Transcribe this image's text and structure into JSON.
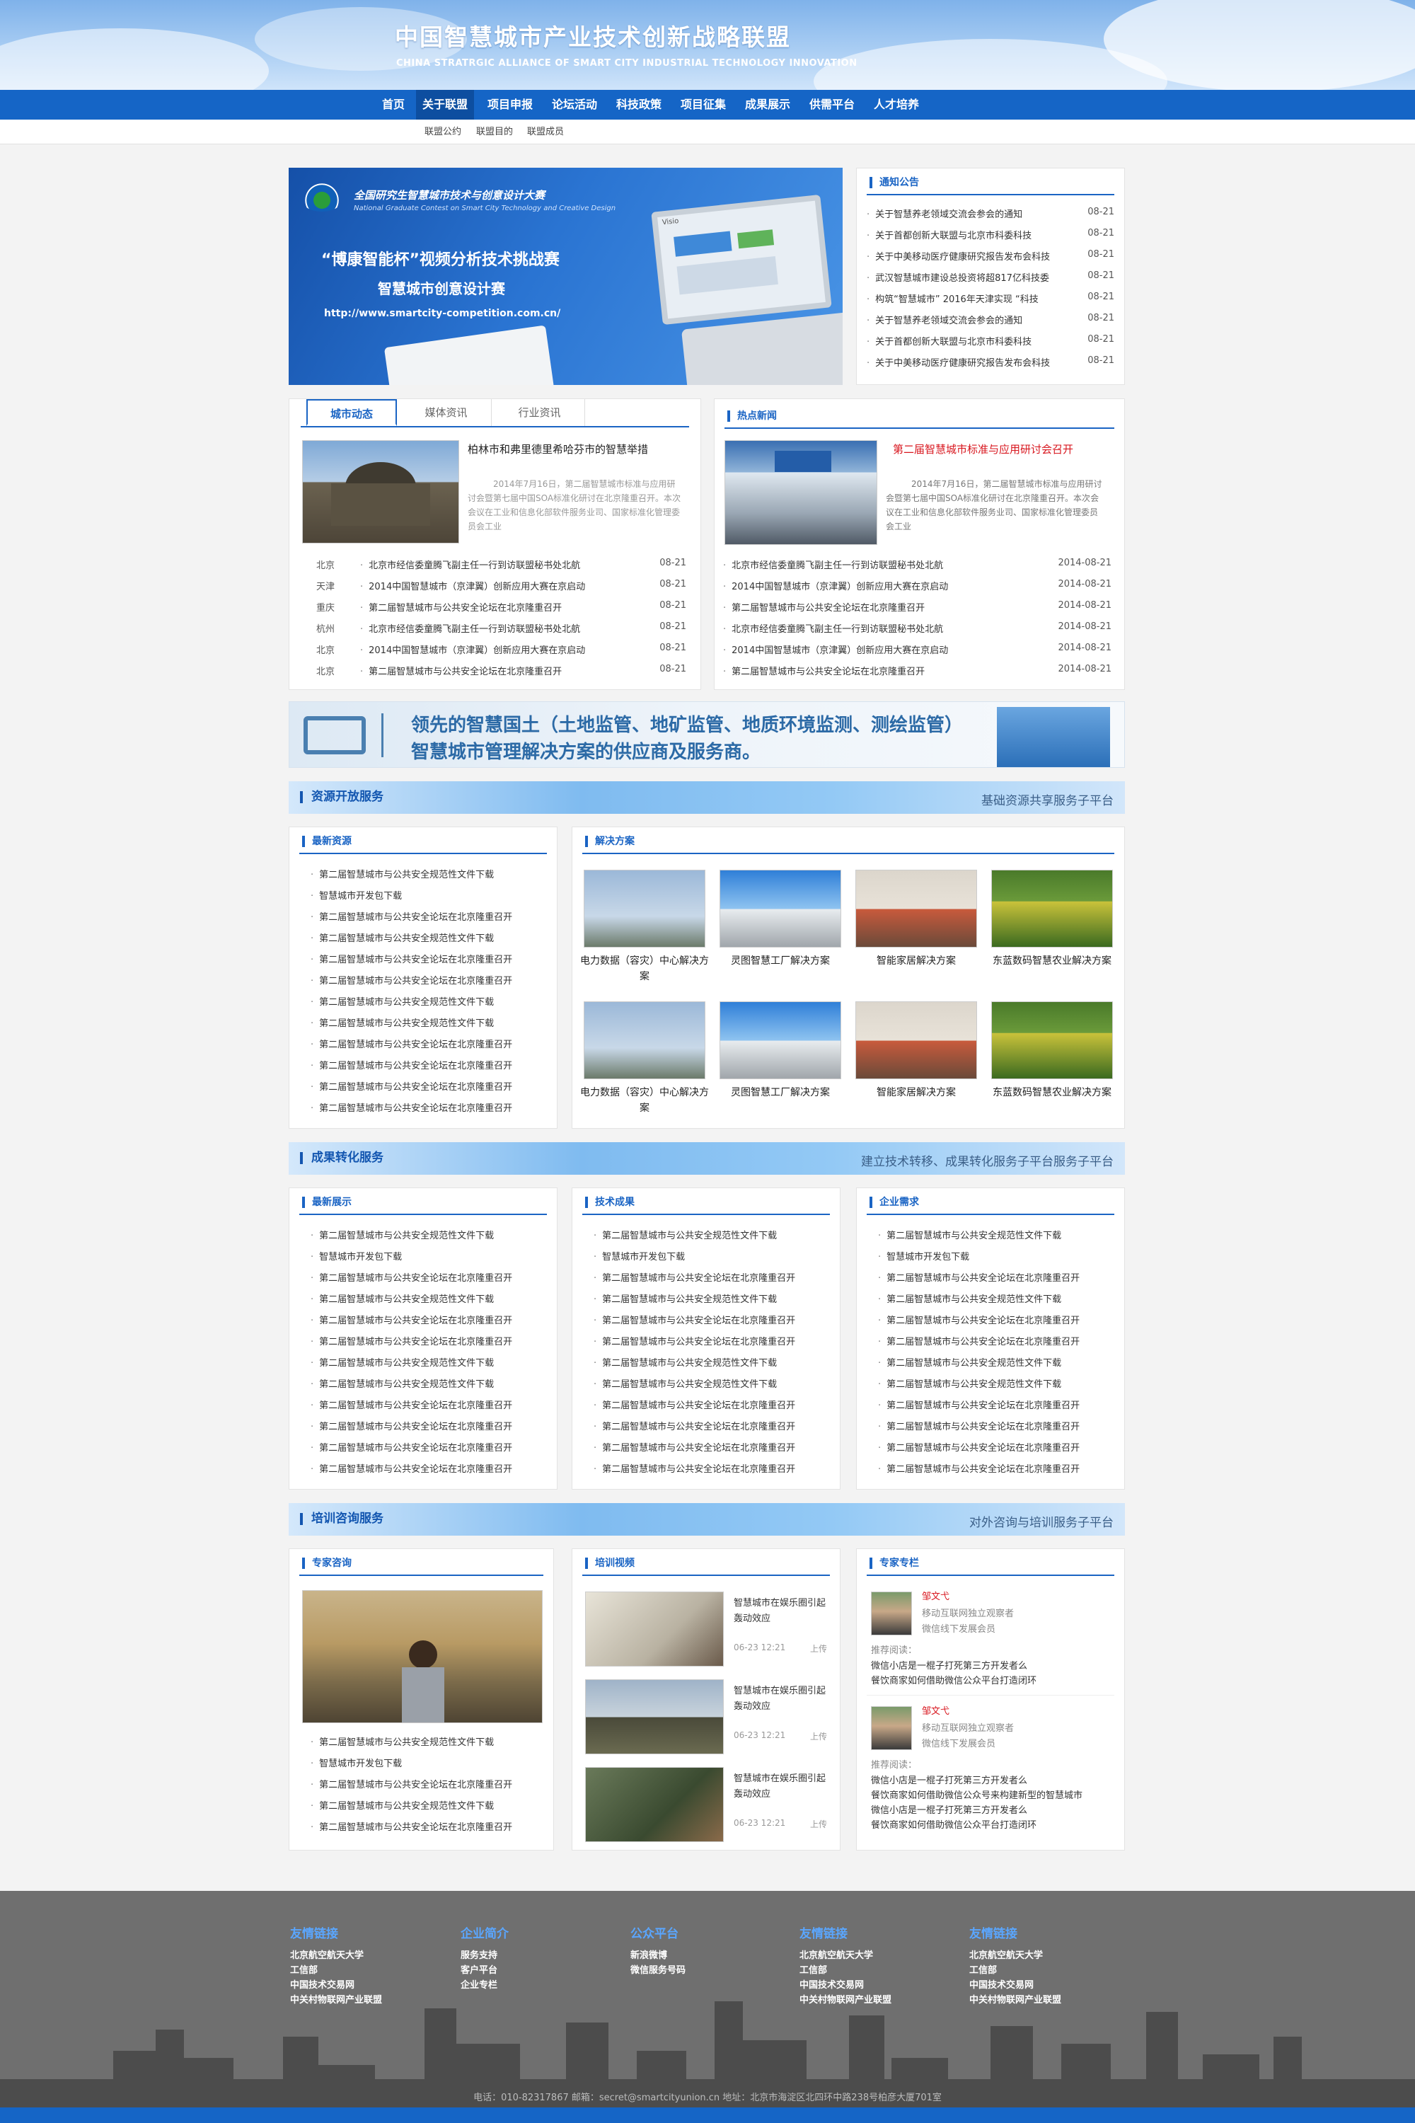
{
  "header": {
    "title": "中国智慧城市产业技术创新战略联盟",
    "subtitle": "CHINA STRATRGIC ALLIANCE OF SMART CITY INDUSTRIAL TECHNOLOGY INNOVATION"
  },
  "nav": [
    "首页",
    "关于联盟",
    "项目申报",
    "论坛活动",
    "科技政策",
    "项目征集",
    "成果展示",
    "供需平台",
    "人才培养"
  ],
  "subnav": [
    "联盟公约",
    "联盟目的",
    "联盟成员"
  ],
  "banner": {
    "line1": "全国研究生智慧城市技术与创意设计大赛",
    "line2": "National Graduate Contest on Smart City Technology and Creative Design",
    "line3": "“博康智能杯”视频分析技术挑战赛",
    "line4": "智慧城市创意设计赛",
    "url": "http://www.smartcity-competition.com.cn/",
    "screen": "Visio"
  },
  "notice": {
    "title": "通知公告",
    "items": [
      {
        "t": "关于智慧养老领域交流会参会的通知",
        "d": "08-21"
      },
      {
        "t": "关于首都创新大联盟与北京市科委科技",
        "d": "08-21"
      },
      {
        "t": "关于中美移动医疗健康研究报告发布会科技",
        "d": "08-21"
      },
      {
        "t": "武汉智慧城市建设总投资将超817亿科技委",
        "d": "08-21"
      },
      {
        "t": "构筑“智慧城市” 2016年天津实现 “科技",
        "d": "08-21"
      },
      {
        "t": "关于智慧养老领域交流会参会的通知",
        "d": "08-21"
      },
      {
        "t": "关于首都创新大联盟与北京市科委科技",
        "d": "08-21"
      },
      {
        "t": "关于中美移动医疗健康研究报告发布会科技",
        "d": "08-21"
      }
    ]
  },
  "city": {
    "tabs": [
      "城市动态",
      "媒体资讯",
      "行业资讯"
    ],
    "feature_title": "柏林市和弗里德里希哈芬市的智慧举措",
    "feature_text": "2014年7月16日，第二届智慧城市标准与应用研讨会暨第七届中国SOA标准化研讨在北京隆重召开。本次会议在工业和信息化部软件服务业司、国家标准化管理委员会工业",
    "items": [
      {
        "c": "北京",
        "t": "北京市经信委童腾飞副主任一行到访联盟秘书处北航",
        "d": "08-21"
      },
      {
        "c": "天津",
        "t": "2014中国智慧城市（京津翼）创新应用大赛在京启动",
        "d": "08-21"
      },
      {
        "c": "重庆",
        "t": "第二届智慧城市与公共安全论坛在北京隆重召开",
        "d": "08-21"
      },
      {
        "c": "杭州",
        "t": "北京市经信委童腾飞副主任一行到访联盟秘书处北航",
        "d": "08-21"
      },
      {
        "c": "北京",
        "t": "2014中国智慧城市（京津翼）创新应用大赛在京启动",
        "d": "08-21"
      },
      {
        "c": "北京",
        "t": "第二届智慧城市与公共安全论坛在北京隆重召开",
        "d": "08-21"
      }
    ]
  },
  "hot": {
    "title": "热点新闻",
    "feature_title": "第二届智慧城市标准与应用研讨会召开",
    "feature_text": "2014年7月16日，第二届智慧城市标准与应用研讨会暨第七届中国SOA标准化研讨在北京隆重召开。本次会议在工业和信息化部软件服务业司、国家标准化管理委员会工业",
    "items": [
      {
        "t": "北京市经信委童腾飞副主任一行到访联盟秘书处北航",
        "d": "2014-08-21"
      },
      {
        "t": "2014中国智慧城市（京津翼）创新应用大赛在京启动",
        "d": "2014-08-21"
      },
      {
        "t": "第二届智慧城市与公共安全论坛在北京隆重召开",
        "d": "2014-08-21"
      },
      {
        "t": "北京市经信委童腾飞副主任一行到访联盟秘书处北航",
        "d": "2014-08-21"
      },
      {
        "t": "2014中国智慧城市（京津翼）创新应用大赛在京启动",
        "d": "2014-08-21"
      },
      {
        "t": "第二届智慧城市与公共安全论坛在北京隆重召开",
        "d": "2014-08-21"
      }
    ]
  },
  "ad": {
    "line1": "领先的智慧国土（土地监管、地矿监管、地质环境监测、测绘监管）",
    "line2": "智慧城市管理解决方案的供应商及服务商。"
  },
  "sec1": {
    "left": "资源开放服务",
    "right": "基础资源共享服务子平台"
  },
  "latest": {
    "title": "最新资源",
    "items": [
      "第二届智慧城市与公共安全规范性文件下载",
      "智慧城市开发包下载",
      "第二届智慧城市与公共安全论坛在北京隆重召开",
      "第二届智慧城市与公共安全规范性文件下载",
      "第二届智慧城市与公共安全论坛在北京隆重召开",
      "第二届智慧城市与公共安全论坛在北京隆重召开",
      "第二届智慧城市与公共安全规范性文件下载",
      "第二届智慧城市与公共安全规范性文件下载",
      "第二届智慧城市与公共安全论坛在北京隆重召开",
      "第二届智慧城市与公共安全论坛在北京隆重召开",
      "第二届智慧城市与公共安全论坛在北京隆重召开",
      "第二届智慧城市与公共安全论坛在北京隆重召开"
    ]
  },
  "solutions": {
    "title": "解决方案",
    "items": [
      "电力数据（容灾）中心解决方案",
      "灵图智慧工厂解决方案",
      "智能家居解决方案",
      "东蓝数码智慧农业解决方案",
      "电力数据（容灾）中心解决方案",
      "灵图智慧工厂解决方案",
      "智能家居解决方案",
      "东蓝数码智慧农业解决方案"
    ]
  },
  "sec2": {
    "left": "成果转化服务",
    "right": "建立技术转移、成果转化服务子平台服务子平台"
  },
  "cols": [
    {
      "title": "最新展示",
      "items": [
        "第二届智慧城市与公共安全规范性文件下载",
        "智慧城市开发包下载",
        "第二届智慧城市与公共安全论坛在北京隆重召开",
        "第二届智慧城市与公共安全规范性文件下载",
        "第二届智慧城市与公共安全论坛在北京隆重召开",
        "第二届智慧城市与公共安全论坛在北京隆重召开",
        "第二届智慧城市与公共安全规范性文件下载",
        "第二届智慧城市与公共安全规范性文件下载",
        "第二届智慧城市与公共安全论坛在北京隆重召开",
        "第二届智慧城市与公共安全论坛在北京隆重召开",
        "第二届智慧城市与公共安全论坛在北京隆重召开",
        "第二届智慧城市与公共安全论坛在北京隆重召开"
      ]
    },
    {
      "title": "技术成果",
      "items": [
        "第二届智慧城市与公共安全规范性文件下载",
        "智慧城市开发包下载",
        "第二届智慧城市与公共安全论坛在北京隆重召开",
        "第二届智慧城市与公共安全规范性文件下载",
        "第二届智慧城市与公共安全论坛在北京隆重召开",
        "第二届智慧城市与公共安全论坛在北京隆重召开",
        "第二届智慧城市与公共安全规范性文件下载",
        "第二届智慧城市与公共安全规范性文件下载",
        "第二届智慧城市与公共安全论坛在北京隆重召开",
        "第二届智慧城市与公共安全论坛在北京隆重召开",
        "第二届智慧城市与公共安全论坛在北京隆重召开",
        "第二届智慧城市与公共安全论坛在北京隆重召开"
      ]
    },
    {
      "title": "企业需求",
      "items": [
        "第二届智慧城市与公共安全规范性文件下载",
        "智慧城市开发包下载",
        "第二届智慧城市与公共安全论坛在北京隆重召开",
        "第二届智慧城市与公共安全规范性文件下载",
        "第二届智慧城市与公共安全论坛在北京隆重召开",
        "第二届智慧城市与公共安全论坛在北京隆重召开",
        "第二届智慧城市与公共安全规范性文件下载",
        "第二届智慧城市与公共安全规范性文件下载",
        "第二届智慧城市与公共安全论坛在北京隆重召开",
        "第二届智慧城市与公共安全论坛在北京隆重召开",
        "第二届智慧城市与公共安全论坛在北京隆重召开",
        "第二届智慧城市与公共安全论坛在北京隆重召开"
      ]
    }
  ],
  "sec3": {
    "left": "培训咨询服务",
    "right": "对外咨询与培训服务子平台"
  },
  "expert": {
    "title": "专家咨询",
    "items": [
      "第二届智慧城市与公共安全规范性文件下载",
      "智慧城市开发包下载",
      "第二届智慧城市与公共安全论坛在北京隆重召开",
      "第二届智慧城市与公共安全规范性文件下载",
      "第二届智慧城市与公共安全论坛在北京隆重召开"
    ]
  },
  "video": {
    "title": "培训视频",
    "items": [
      {
        "t": "智慧城市在娱乐圈引起轰动效应",
        "time": "06-23 12:21",
        "tag": "上传"
      },
      {
        "t": "智慧城市在娱乐圈引起轰动效应",
        "time": "06-23 12:21",
        "tag": "上传"
      },
      {
        "t": "智慧城市在娱乐圈引起轰动效应",
        "time": "06-23 12:21",
        "tag": "上传"
      }
    ]
  },
  "column": {
    "title": "专家专栏",
    "people": [
      {
        "name": "邹文弋",
        "role": "移动互联网独立观察者",
        "org": "微信线下发展会员",
        "rec": "推荐阅读：",
        "links": [
          "微信小店是一棍子打死第三方开发者么",
          "餐饮商家如何借助微信公众平台打造闭环"
        ]
      },
      {
        "name": "邹文弋",
        "role": "移动互联网独立观察者",
        "org": "微信线下发展会员",
        "rec": "推荐阅读：",
        "links": [
          "微信小店是一棍子打死第三方开发者么",
          "餐饮商家如何借助微信公众号来构建新型的智慧城市",
          "微信小店是一棍子打死第三方开发者么",
          "餐饮商家如何借助微信公众平台打造闭环"
        ]
      }
    ]
  },
  "footer": {
    "cols": [
      {
        "h": "友情链接",
        "l": [
          "北京航空航天大学",
          "工信部",
          "中国技术交易网",
          "中关村物联网产业联盟"
        ]
      },
      {
        "h": "企业简介",
        "l": [
          "服务支持",
          "客户平台",
          "企业专栏"
        ]
      },
      {
        "h": "公众平台",
        "l": [
          "新浪微博",
          "微信服务号码"
        ]
      },
      {
        "h": "友情链接",
        "l": [
          "北京航空航天大学",
          "工信部",
          "中国技术交易网",
          "中关村物联网产业联盟"
        ]
      },
      {
        "h": "友情链接",
        "l": [
          "北京航空航天大学",
          "工信部",
          "中国技术交易网",
          "中关村物联网产业联盟"
        ]
      }
    ],
    "contact": "电话：010-82317867 邮箱：secret@smartcityunion.cn 地址：北京市海淀区北四环中路238号柏彦大厦701室"
  },
  "colors": {
    "primary": "#1565c6",
    "accent": "#1a64c4",
    "hot_title": "#d8161e",
    "footer": "#6f6f6f"
  }
}
